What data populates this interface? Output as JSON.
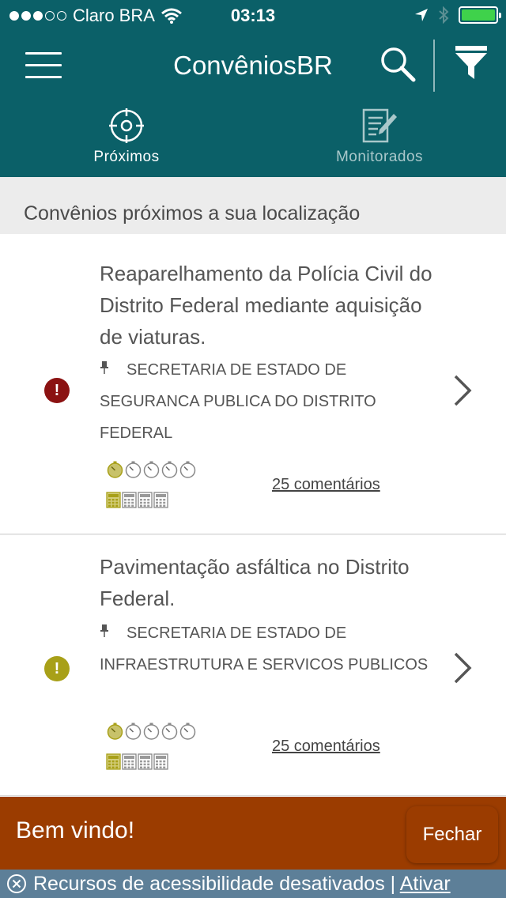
{
  "status_bar": {
    "carrier": "Claro BRA",
    "time": "03:13"
  },
  "header": {
    "title": "ConvêniosBR",
    "icons": [
      "menu-icon",
      "search-icon",
      "filter-icon"
    ],
    "background_color": "#0b6068"
  },
  "tabs": [
    {
      "label": "Próximos",
      "icon": "target-icon",
      "active": true
    },
    {
      "label": "Monitorados",
      "icon": "edit-document-icon",
      "active": false
    }
  ],
  "section": {
    "title": "Convênios próximos a sua localização"
  },
  "items": [
    {
      "title": "Reaparelhamento da Polícia Civil do Distrito Federal mediante aquisição de viaturas.",
      "agency": "SECRETARIA DE ESTADO DE SEGURANCA PUBLICA DO DISTRITO FEDERAL",
      "status_color": "#8b1212",
      "status_symbol": "!",
      "time_progress": "1/5",
      "budget_progress": "1/4",
      "comments": "25 comentários"
    },
    {
      "title": "Pavimentação asfáltica no Distrito Federal.",
      "agency": "SECRETARIA DE ESTADO DE INFRAESTRUTURA E SERVICOS PUBLICOS",
      "status_color": "#a8a018",
      "status_symbol": "!",
      "time_progress": "1/5",
      "budget_progress": "1/4",
      "comments": "25 comentários"
    }
  ],
  "welcome": {
    "text": "Bem vindo!",
    "close_label": "Fechar",
    "background_color": "#9b3c00"
  },
  "accessibility": {
    "text": "Recursos de acessibilidade desativados",
    "separator": "|",
    "link": "Ativar"
  }
}
